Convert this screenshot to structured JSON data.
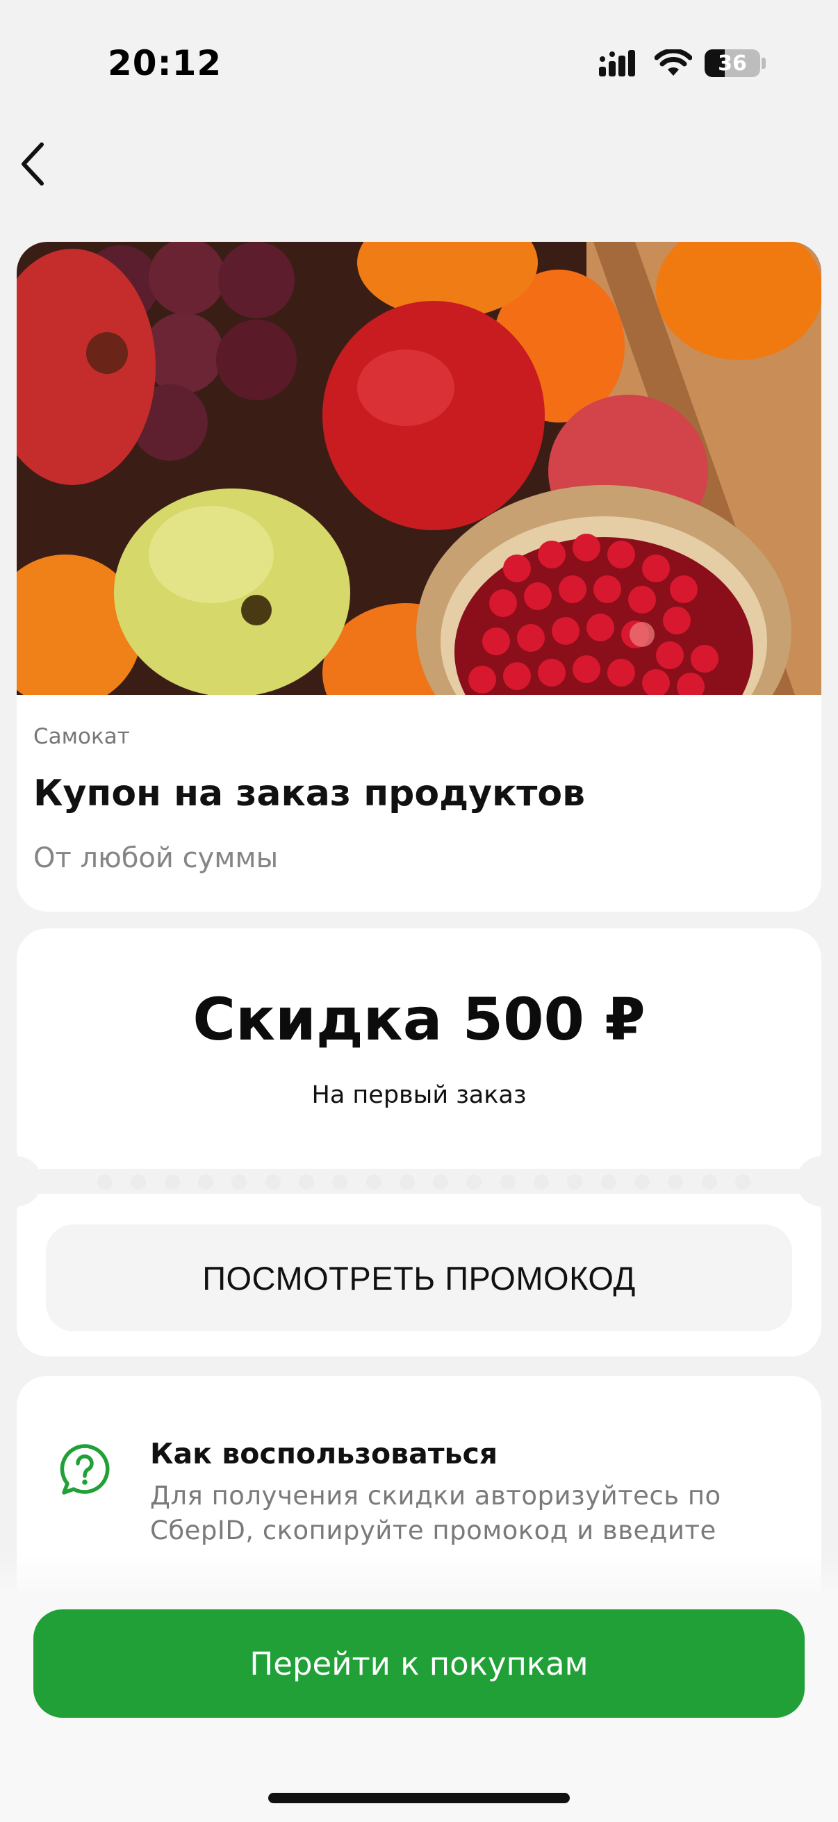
{
  "status_bar": {
    "time": "20:12",
    "battery_level": "36",
    "icons": [
      "signal-icon",
      "wifi-icon",
      "battery-icon"
    ]
  },
  "navigation": {
    "back_icon": "chevron-left-icon"
  },
  "hero": {
    "image_description_icon": "fruit-photo",
    "brand": "Самокат",
    "title": "Купон на заказ продуктов",
    "subtitle": "От любой суммы"
  },
  "coupon": {
    "discount": "Скидка 500 ₽",
    "condition": "На первый заказ",
    "promo_button_label": "ПОСМОТРЕТЬ ПРОМОКОД"
  },
  "how_to": {
    "icon": "question-chat-icon",
    "title": "Как воспользоваться",
    "text": "Для получения скидки авторизуйтесь по СберID, скопируйте промокод и введите"
  },
  "cta": {
    "label": "Перейти к покупкам"
  },
  "colors": {
    "brand_green": "#21A038",
    "background": "#F2F2F2",
    "card": "#FFFFFF",
    "muted_text": "#858585"
  }
}
